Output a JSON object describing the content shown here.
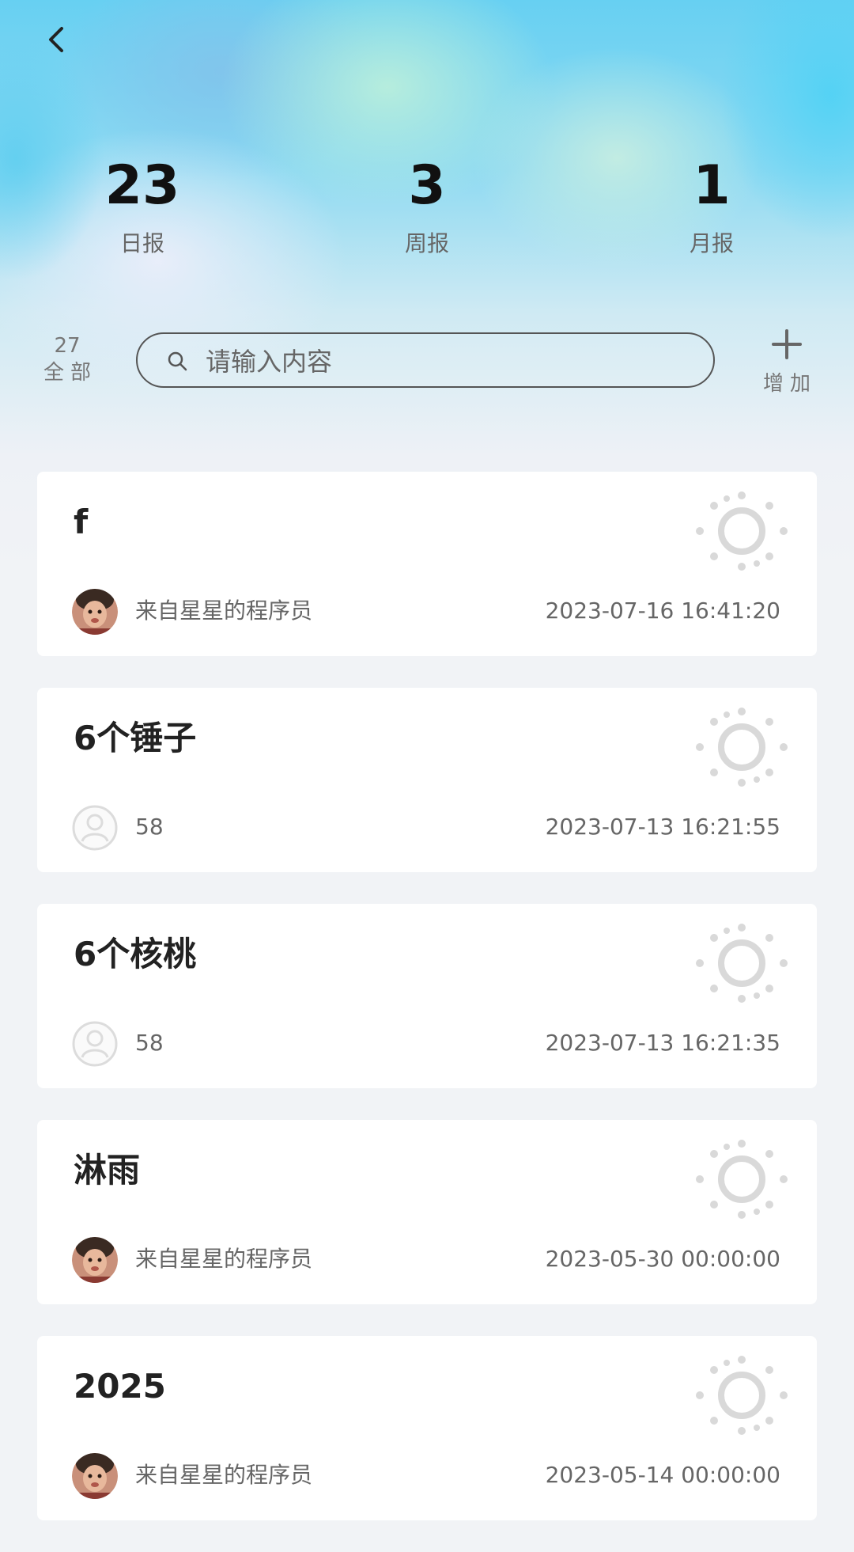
{
  "header": {
    "back_icon": "chevron-left-icon"
  },
  "stats": [
    {
      "count": "23",
      "label": "日报"
    },
    {
      "count": "3",
      "label": "周报"
    },
    {
      "count": "1",
      "label": "月报"
    }
  ],
  "filter": {
    "all_count": "27",
    "all_label": "全部"
  },
  "search": {
    "placeholder": "请输入内容",
    "value": "",
    "icon": "search-icon"
  },
  "add": {
    "label": "增加",
    "icon": "plus-icon"
  },
  "reports": [
    {
      "title": "f",
      "author": "来自星星的程序员",
      "time": "2023-07-16 16:41:20",
      "avatar": "photo",
      "icon": "sun-icon"
    },
    {
      "title": "6个锤子",
      "author": "58",
      "time": "2023-07-13 16:21:55",
      "avatar": "default",
      "icon": "sun-icon"
    },
    {
      "title": "6个核桃",
      "author": "58",
      "time": "2023-07-13 16:21:35",
      "avatar": "default",
      "icon": "sun-icon"
    },
    {
      "title": "淋雨",
      "author": "来自星星的程序员",
      "time": "2023-05-30 00:00:00",
      "avatar": "photo",
      "icon": "sun-icon"
    },
    {
      "title": "2025",
      "author": "来自星星的程序员",
      "time": "2023-05-14 00:00:00",
      "avatar": "photo",
      "icon": "sun-icon"
    }
  ],
  "colors": {
    "accent_sky": "#67d0f2",
    "card_bg": "#ffffff",
    "page_bg": "#f1f3f6",
    "sun_gray": "#d9d9d9"
  }
}
